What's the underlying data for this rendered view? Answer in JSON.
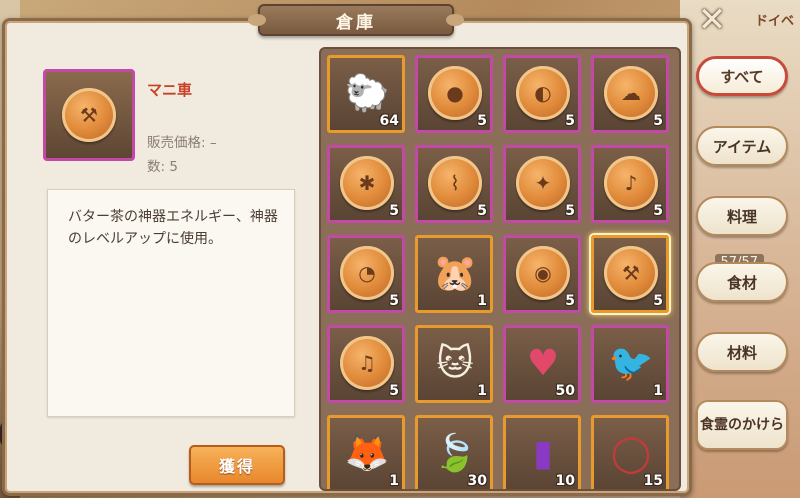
{
  "window": {
    "title": "倉庫",
    "close_symbol": "✕"
  },
  "background": {
    "right_text": "ドイベ",
    "right_stat": "57/57"
  },
  "detail": {
    "name": "マニ車",
    "price_label": "販売価格: –",
    "count_label": "数: 5",
    "description": "バター茶の神器エネルギー、神器のレベルアップに使用。",
    "obtain_button": "獲得"
  },
  "tabs": [
    {
      "label": "すべて",
      "active": true
    },
    {
      "label": "アイテム",
      "active": false
    },
    {
      "label": "料理",
      "active": false
    },
    {
      "label": "食材",
      "active": false
    },
    {
      "label": "材料",
      "active": false
    },
    {
      "label": "食霊のかけら",
      "active": false
    }
  ],
  "inventory": [
    {
      "icon": "sheep-group-icon",
      "count": "64",
      "border": "orange"
    },
    {
      "icon": "butter-cake-icon",
      "glyph": "●",
      "count": "5",
      "border": "purple"
    },
    {
      "icon": "butter-cake-icon",
      "glyph": "◐",
      "count": "5",
      "border": "purple"
    },
    {
      "icon": "butter-cake-icon",
      "glyph": "☁",
      "count": "5",
      "border": "purple"
    },
    {
      "icon": "butter-cake-icon",
      "glyph": "✱",
      "count": "5",
      "border": "purple"
    },
    {
      "icon": "butter-cake-icon",
      "glyph": "⌇",
      "count": "5",
      "border": "purple"
    },
    {
      "icon": "butter-cake-icon",
      "glyph": "✦",
      "count": "5",
      "border": "purple"
    },
    {
      "icon": "butter-cake-icon",
      "glyph": "♪",
      "count": "5",
      "border": "purple"
    },
    {
      "icon": "butter-cake-icon",
      "glyph": "◔",
      "count": "5",
      "border": "purple"
    },
    {
      "icon": "hamster-icon",
      "count": "1",
      "border": "orange"
    },
    {
      "icon": "butter-cake-icon",
      "glyph": "◉",
      "count": "5",
      "border": "purple"
    },
    {
      "icon": "butter-cake-icon",
      "glyph": "⚒",
      "count": "5",
      "border": "orange",
      "selected": true
    },
    {
      "icon": "butter-cake-icon",
      "glyph": "♫",
      "count": "5",
      "border": "purple"
    },
    {
      "icon": "white-cat-icon",
      "count": "1",
      "border": "orange"
    },
    {
      "icon": "heart-emblem-icon",
      "count": "50",
      "border": "purple"
    },
    {
      "icon": "magpie-bird-icon",
      "count": "1",
      "border": "purple"
    },
    {
      "icon": "white-fox-icon",
      "count": "1",
      "border": "orange"
    },
    {
      "icon": "tea-leaf-icon",
      "count": "30",
      "border": "orange"
    },
    {
      "icon": "purple-pouch-icon",
      "count": "10",
      "border": "orange"
    },
    {
      "icon": "bead-bracelet-icon",
      "count": "15",
      "border": "orange"
    }
  ]
}
